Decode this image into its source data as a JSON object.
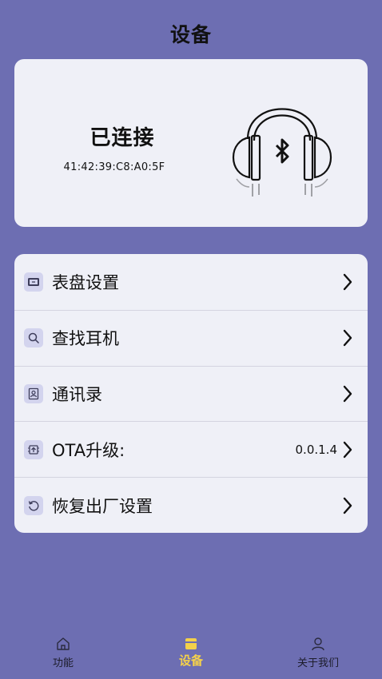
{
  "header": {
    "title": "设备"
  },
  "device": {
    "status": "已连接",
    "mac": "41:42:39:C8:A0:5F",
    "image_icon": "bluetooth-headphones-icon"
  },
  "menu": {
    "items": [
      {
        "label": "表盘设置",
        "icon": "watch-face-icon",
        "value": ""
      },
      {
        "label": "查找耳机",
        "icon": "search-icon",
        "value": ""
      },
      {
        "label": "通讯录",
        "icon": "contacts-icon",
        "value": ""
      },
      {
        "label": "OTA升级:",
        "icon": "ota-upgrade-icon",
        "value": "0.0.1.4"
      },
      {
        "label": "恢复出厂设置",
        "icon": "reset-icon",
        "value": ""
      }
    ]
  },
  "tabbar": {
    "tabs": [
      {
        "label": "功能",
        "icon": "home-icon",
        "active": false
      },
      {
        "label": "设备",
        "icon": "device-icon",
        "active": true
      },
      {
        "label": "关于我们",
        "icon": "user-icon",
        "active": false
      }
    ]
  },
  "colors": {
    "background": "#6d6eb2",
    "card": "#eff0f7",
    "icon_bg": "#d3d4ee",
    "active_tab": "#f4d14a"
  }
}
